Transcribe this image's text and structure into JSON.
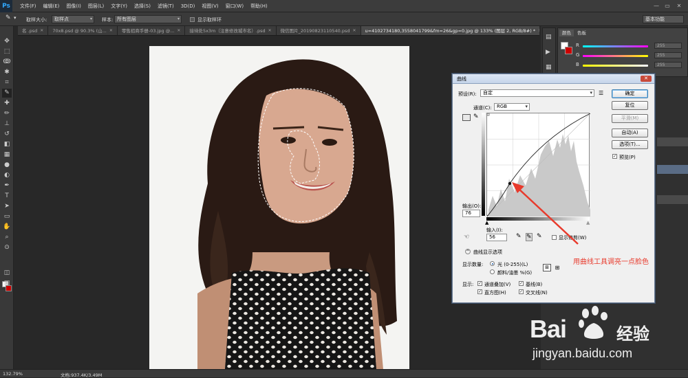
{
  "app": {
    "logo": "Ps"
  },
  "menu": [
    "文件(F)",
    "编辑(E)",
    "图像(I)",
    "图层(L)",
    "文字(Y)",
    "选择(S)",
    "滤镜(T)",
    "3D(D)",
    "视图(V)",
    "窗口(W)",
    "帮助(H)"
  ],
  "options": {
    "sample_size_label": "取样大小:",
    "sample_size_value": "取样点",
    "sample_label": "样本:",
    "sample_value": "所有图层",
    "show_ring_label": "显示取样环",
    "workspace": "基本功能"
  },
  "tabs": [
    {
      "label": "名 .psd",
      "active": false
    },
    {
      "label": "70x8.psd @ 90.3% (山...",
      "active": false
    },
    {
      "label": "零售招商手册-03.jpg @...",
      "active": false
    },
    {
      "label": "接待处5x3m（注意修改城市名）.psd",
      "active": false
    },
    {
      "label": "微信图片_20190823110540.psd",
      "active": false
    },
    {
      "label": "u=4102734180,3558041799&fm=26&gp=0.jpg @ 133% (图层 2, RGB/8#) *",
      "active": true
    }
  ],
  "color_panel": {
    "tab1": "颜色",
    "tab2": "色板",
    "r": "255",
    "g": "255",
    "b": "255"
  },
  "status": {
    "zoom": "132.79%",
    "doc": "文档:937.4K/3.49M"
  },
  "curves": {
    "title": "曲线",
    "preset_label": "预设(R):",
    "preset_value": "自定",
    "channel_label": "通道(C):",
    "channel_value": "RGB",
    "output_label": "输出(O):",
    "output_value": "76",
    "input_label": "输入(I):",
    "input_value": "56",
    "show_clipping": "显示修剪(W)",
    "display_options": "曲线显示选项",
    "show_amount_label": "显示数量:",
    "light_option": "光 (0-255)(L)",
    "pigment_option": "颜料/油墨 %(G)",
    "show_label": "显示:",
    "channel_overlays": "通道叠加(V)",
    "baseline": "基线(B)",
    "histogram": "直方图(H)",
    "intersection": "交叉线(N)",
    "btn_ok": "确定",
    "btn_reset": "复位",
    "btn_smooth": "平滑(M)",
    "btn_auto": "自动(A)",
    "btn_options": "选项(T)...",
    "preview": "预览(P)"
  },
  "annotation": "用曲线工具调亮一点脸色",
  "watermark": {
    "brand": "Bai",
    "brand2": "经验",
    "url": "jingyan.baidu.com"
  }
}
